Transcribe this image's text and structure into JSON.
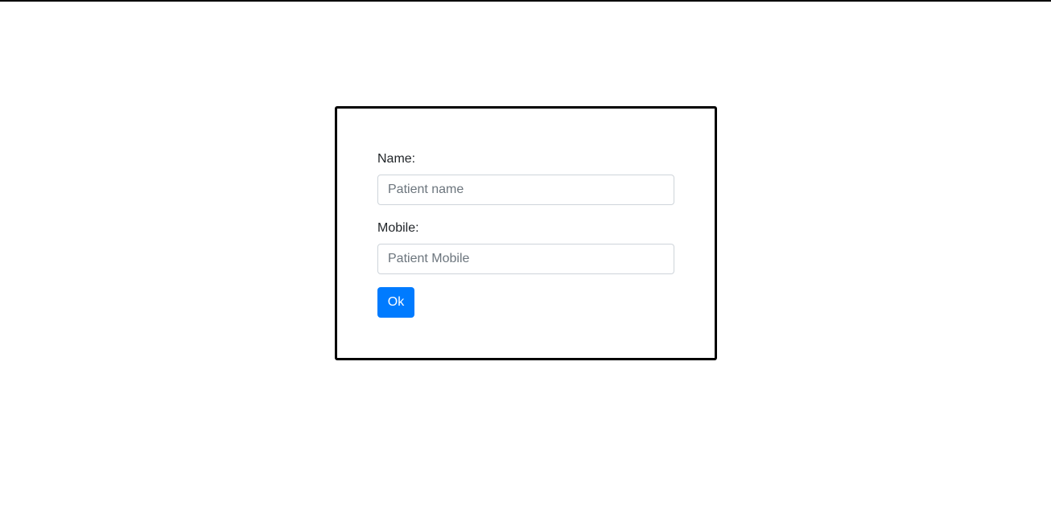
{
  "form": {
    "name_label": "Name:",
    "name_placeholder": "Patient name",
    "name_value": "",
    "mobile_label": "Mobile:",
    "mobile_placeholder": "Patient Mobile",
    "mobile_value": "",
    "submit_label": "Ok"
  },
  "colors": {
    "primary": "#007bff",
    "card_border": "#000000",
    "input_border": "#ced4da",
    "placeholder": "#6c757d",
    "text": "#212529"
  }
}
